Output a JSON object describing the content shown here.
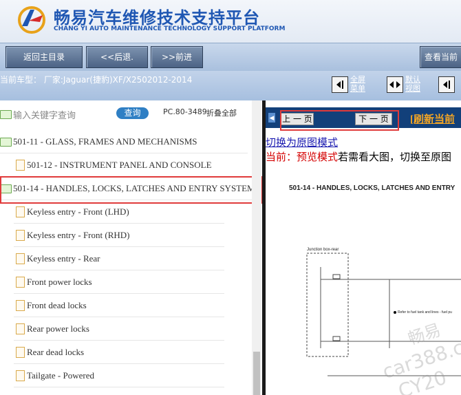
{
  "header": {
    "title_cn": "畅易汽车维修技术支持平台",
    "title_en": "CHANG YI AUTO MAINTENANCE TECHNOLOGY SUPPORT PLATFORM"
  },
  "toolbar": {
    "home": "返回主目录",
    "back": "<<后退.",
    "forward": ">>前进",
    "view_current": "查看当前"
  },
  "info": {
    "current_vehicle": "当前车型： 厂家:Jaguar(捷豹)XF/X2502012-2014",
    "fullscreen": "全屏\n菜单",
    "default_view": "默认\n视图"
  },
  "tree": {
    "search_placeholder": "输入关键字查询",
    "search_button": "查询",
    "pc_code": "PC.80-3489",
    "collapse_all": "折叠全部",
    "sections": [
      "501-11 - GLASS, FRAMES AND MECHANISMS",
      "501-12 - INSTRUMENT PANEL AND CONSOLE",
      "501-14 - HANDLES, LOCKS, LATCHES AND ENTRY SYSTEM"
    ],
    "items": [
      "Keyless entry - Front (LHD)",
      "Keyless entry - Front (RHD)",
      "Keyless entry - Rear",
      "Front power locks",
      "Front dead locks",
      "Rear power locks",
      "Rear dead locks",
      "Tailgate - Powered"
    ]
  },
  "viewer": {
    "prev_page": "上 一 页",
    "next_page": "下 一 页",
    "refresh": "[刷新当前",
    "switch_original": "切换为原图模式",
    "current_mode_prefix": "当前：",
    "current_mode": "预览模式",
    "hint": "若需看大图，切换至原图",
    "diagram_title": "501-14 - HANDLES, LOCKS, LATCHES AND ENTRY",
    "box_label": "Junction box-rear",
    "note": "Refer to fuel tank and lines - fuel pu",
    "watermark1": "畅易",
    "watermark2": "car388.c",
    "watermark3": "CY20"
  }
}
